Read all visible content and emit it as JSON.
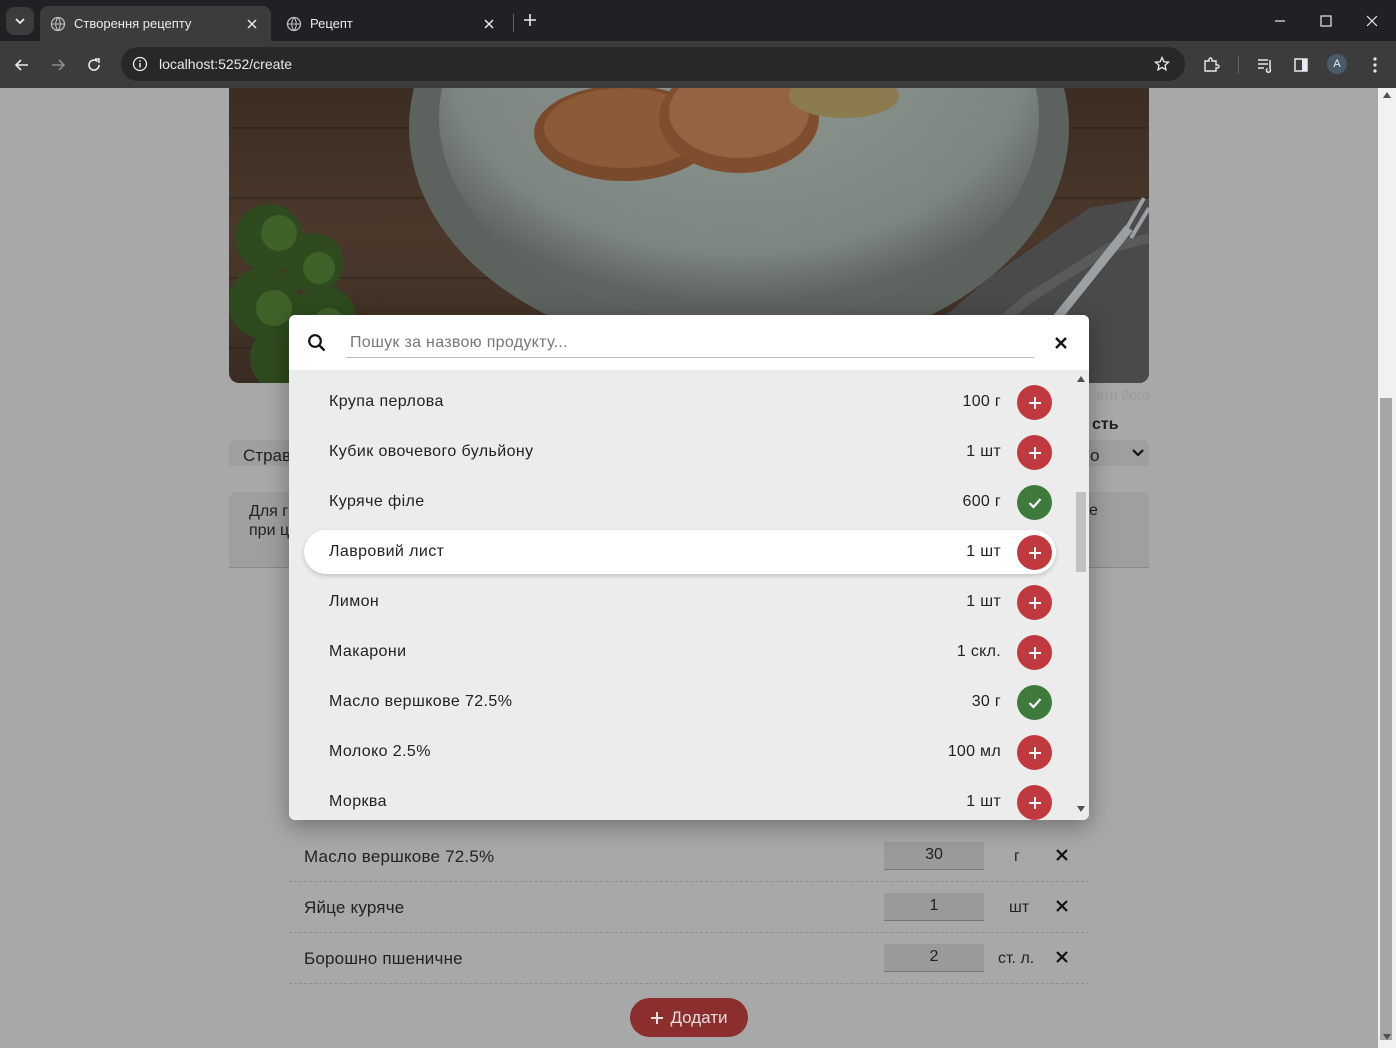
{
  "browser": {
    "tabs": [
      {
        "title": "Створення рецепту",
        "active": true
      },
      {
        "title": "Рецепт",
        "active": false
      }
    ],
    "address": "localhost:5252/create",
    "profile_initial": "A"
  },
  "page": {
    "image_hint": "ати його",
    "right_label": "сть",
    "category_value": "Страв",
    "difficulty_value": "о",
    "description_left": "Для г при ц",
    "description_right": "е",
    "ingredients": [
      {
        "name": "Масло вершкове 72.5%",
        "quantity": "30",
        "unit": "г"
      },
      {
        "name": "Яйце куряче",
        "quantity": "1",
        "unit": "шт"
      },
      {
        "name": "Борошно пшеничне",
        "quantity": "2",
        "unit": "ст. л."
      }
    ],
    "add_button_label": "Додати"
  },
  "modal": {
    "search_placeholder": "Пошук за назвою продукту...",
    "items": [
      {
        "name": "Крупа перлова",
        "amount": "100 г",
        "added": false
      },
      {
        "name": "Кубик овочевого бульйону",
        "amount": "1 шт",
        "added": false
      },
      {
        "name": "Куряче філе",
        "amount": "600 г",
        "added": true
      },
      {
        "name": "Лавровий лист",
        "amount": "1 шт",
        "added": false,
        "hovered": true
      },
      {
        "name": "Лимон",
        "amount": "1 шт",
        "added": false
      },
      {
        "name": "Макарони",
        "amount": "1 скл.",
        "added": false
      },
      {
        "name": "Масло вершкове 72.5%",
        "amount": "30 г",
        "added": true
      },
      {
        "name": "Молоко 2.5%",
        "amount": "100 мл",
        "added": false
      },
      {
        "name": "Морква",
        "amount": "1 шт",
        "added": false
      }
    ]
  },
  "colors": {
    "add_button": "#c0393e",
    "added_button": "#3d7a3c",
    "primary_button": "#8b2e2e"
  }
}
